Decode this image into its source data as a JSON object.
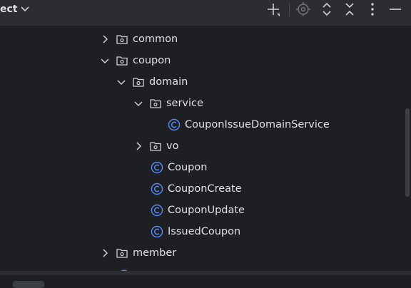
{
  "header": {
    "title": "ect",
    "icons": [
      "chevron-down-icon",
      "add-icon",
      "locate-icon",
      "expand-all-icon",
      "collapse-all-icon",
      "more-options-icon",
      "minimize-icon"
    ]
  },
  "tree": {
    "items": [
      {
        "label": "common",
        "kind": "package",
        "state": "collapsed"
      },
      {
        "label": "coupon",
        "kind": "package",
        "state": "expanded"
      },
      {
        "label": "domain",
        "kind": "package",
        "state": "expanded"
      },
      {
        "label": "service",
        "kind": "package",
        "state": "expanded"
      },
      {
        "label": "CouponIssueDomainService",
        "kind": "class"
      },
      {
        "label": "vo",
        "kind": "package",
        "state": "collapsed"
      },
      {
        "label": "Coupon",
        "kind": "class"
      },
      {
        "label": "CouponCreate",
        "kind": "class"
      },
      {
        "label": "CouponUpdate",
        "kind": "class"
      },
      {
        "label": "IssuedCoupon",
        "kind": "class"
      },
      {
        "label": "member",
        "kind": "package",
        "state": "collapsed"
      }
    ]
  },
  "colors": {
    "background": "#1e1f22",
    "header": "#2b2d30",
    "text": "#dfe1e5",
    "icon": "#ced0d6",
    "class_icon": "#548af7"
  }
}
